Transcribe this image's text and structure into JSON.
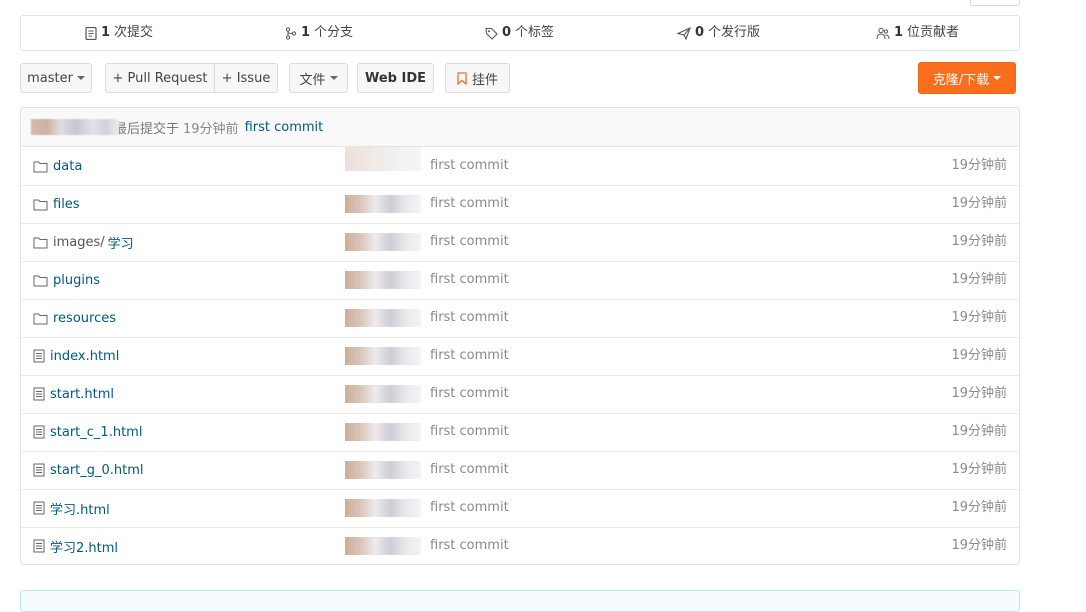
{
  "stats": [
    {
      "count": "1",
      "label": "次提交",
      "icon": "commit-icon"
    },
    {
      "count": "1",
      "label": "个分支",
      "icon": "branch-icon"
    },
    {
      "count": "0",
      "label": "个标签",
      "icon": "tag-icon"
    },
    {
      "count": "0",
      "label": "个发行版",
      "icon": "release-icon"
    },
    {
      "count": "1",
      "label": "位贡献者",
      "icon": "contributors-icon"
    }
  ],
  "toolbar": {
    "branch": "master",
    "pull_request": "+ Pull Request",
    "issue": "+ Issue",
    "files": "文件",
    "web_ide": "Web IDE",
    "bookmark": "挂件",
    "clone": "克隆/下载"
  },
  "last_commit": {
    "prefix": "最后提交于",
    "time": "19分钟前",
    "message": "first commit"
  },
  "files": [
    {
      "type": "folder",
      "name": "data",
      "message": "first commit",
      "time": "19分钟前"
    },
    {
      "type": "folder",
      "name": "files",
      "message": "first commit",
      "time": "19分钟前"
    },
    {
      "type": "folder",
      "name": "images/",
      "name2": "学习",
      "message": "first commit",
      "time": "19分钟前"
    },
    {
      "type": "folder",
      "name": "plugins",
      "message": "first commit",
      "time": "19分钟前"
    },
    {
      "type": "folder",
      "name": "resources",
      "message": "first commit",
      "time": "19分钟前"
    },
    {
      "type": "file",
      "name": "index.html",
      "message": "first commit",
      "time": "19分钟前"
    },
    {
      "type": "file",
      "name": "start.html",
      "message": "first commit",
      "time": "19分钟前"
    },
    {
      "type": "file",
      "name": "start_c_1.html",
      "message": "first commit",
      "time": "19分钟前"
    },
    {
      "type": "file",
      "name": "start_g_0.html",
      "message": "first commit",
      "time": "19分钟前"
    },
    {
      "type": "file",
      "name": "学习.html",
      "message": "first commit",
      "time": "19分钟前"
    },
    {
      "type": "file",
      "name": "学习2.html",
      "message": "first commit",
      "time": "19分钟前"
    }
  ],
  "colors": {
    "accent_orange": "#fa6d1d",
    "link": "#005980",
    "muted": "#8a8a8a"
  }
}
